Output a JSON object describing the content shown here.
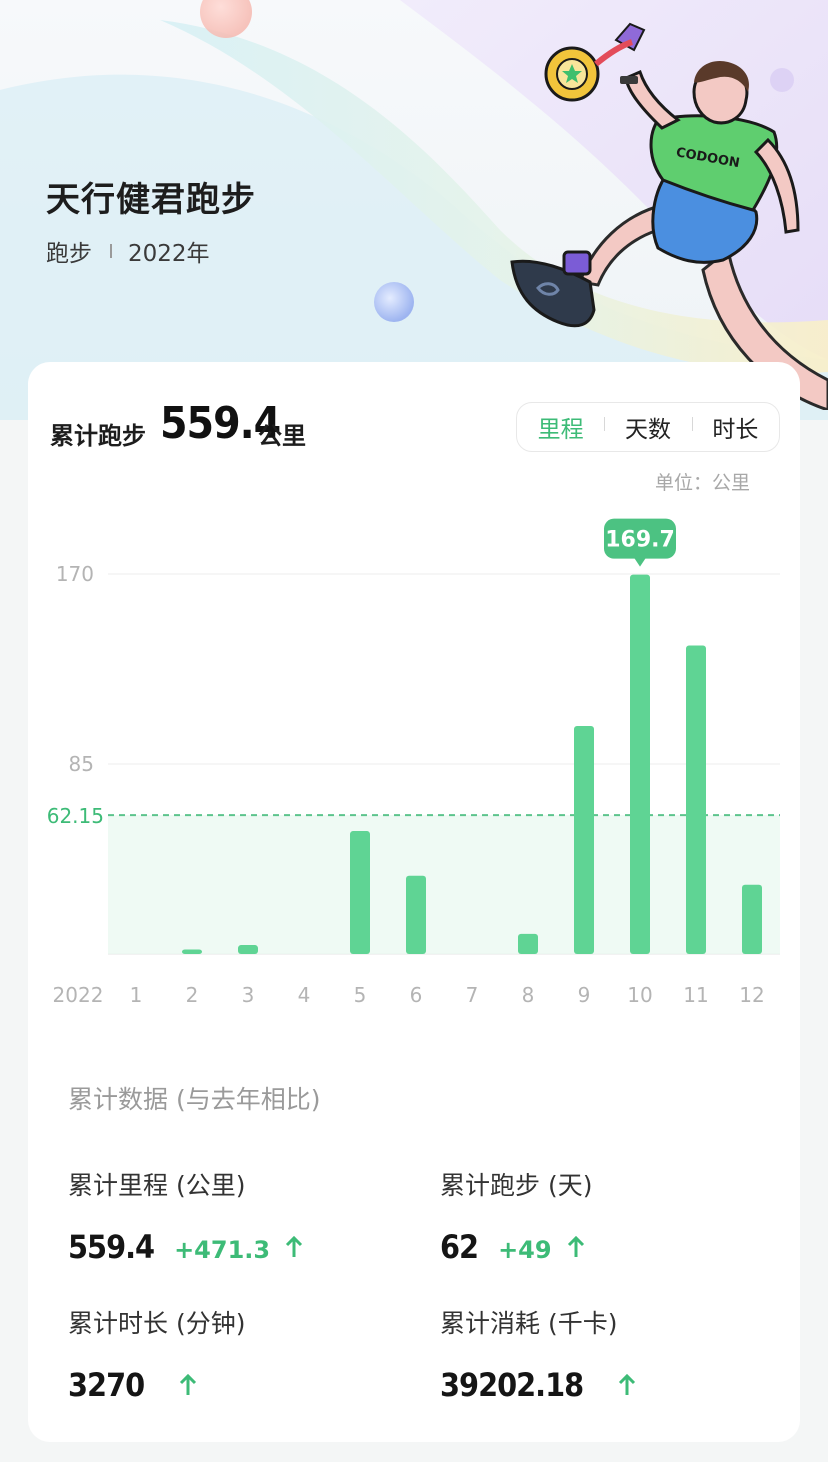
{
  "header": {
    "title": "天行健君跑步",
    "category": "跑步",
    "year": "2022年"
  },
  "summary": {
    "label": "累计跑步",
    "value": "559.4",
    "unit": "公里"
  },
  "segment": {
    "options": [
      "里程",
      "天数",
      "时长"
    ],
    "active_index": 0
  },
  "unit_note": "单位：公里",
  "chart_data": {
    "type": "bar",
    "categories": [
      "1",
      "2",
      "3",
      "4",
      "5",
      "6",
      "7",
      "8",
      "9",
      "10",
      "11",
      "12"
    ],
    "values": [
      0,
      2,
      4,
      0,
      55,
      35,
      0,
      9,
      102,
      169.7,
      138,
      31
    ],
    "year_label": "2022",
    "yticks": [
      "170",
      "85"
    ],
    "ylim": [
      0,
      170
    ],
    "average": 62.15,
    "average_label": "62.15",
    "highlight_label": "169.7",
    "highlight_index": 9,
    "accent": "#5fd494"
  },
  "stats": {
    "section_title": "累计数据 (与去年相比)",
    "items": [
      {
        "label": "累计里程 (公里)",
        "value": "559.4",
        "delta": "+471.3"
      },
      {
        "label": "累计跑步 (天)",
        "value": "62",
        "delta": "+49"
      },
      {
        "label": "累计时长 (分钟)",
        "value": "3270",
        "delta": ""
      },
      {
        "label": "累计消耗 (千卡)",
        "value": "39202.18",
        "delta": ""
      }
    ]
  },
  "colors": {
    "accent_green": "#3dbb77",
    "bar_green": "#5fd494"
  }
}
